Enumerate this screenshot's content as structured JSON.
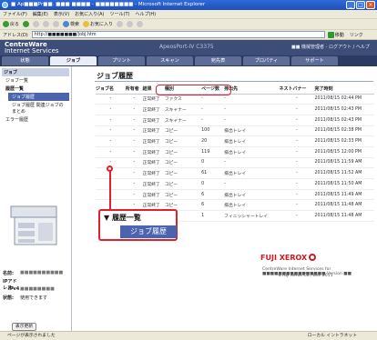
{
  "window": {
    "title": "■ Ap■■■Pr■■. ■■■ ■■■■ - ■■■■■■■■ - Microsoft Internet Explorer",
    "menu": [
      "ファイル(F)",
      "編集(E)",
      "表示(V)",
      "お気に入り(A)",
      "ツール(T)",
      "ヘルプ(H)"
    ],
    "toolbar": {
      "back": "戻る",
      "search": "検索",
      "favorites": "お気に入り"
    },
    "address_label": "アドレス(D)",
    "address_url": "http://■■■■■■■/jobj.htm",
    "go_label": "移動",
    "links_label": "リンク"
  },
  "header": {
    "brand_line1": "CentreWare",
    "brand_line2": "Internet Services",
    "model": "ApeosPort-IV C3375",
    "admin": "■■ 機械管理者 - ログアウト / ヘルプ"
  },
  "tabs": [
    "状態",
    "ジョブ",
    "プリント",
    "スキャン",
    "宛先表",
    "プロパティ",
    "サポート"
  ],
  "sidebar": {
    "section": "ジョブ",
    "items": [
      "ジョブ一覧",
      "履歴一覧",
      "ジョブ履歴",
      "ジョブ履歴 関連ジョブのまとめ",
      "エラー履歴"
    ],
    "info": {
      "name_label": "名前:",
      "name_value": "■■■■■■■■■■",
      "ip_label": "IPアドレス:",
      "ipv4_label": "IPv4",
      "ipv4_value": "■■■■■■■■",
      "status_label": "状態:",
      "status_value": "使用できます"
    },
    "refresh_label": "表示更新"
  },
  "main": {
    "title": "ジョブ履歴",
    "columns": [
      "ジョブ名",
      "所有者",
      "結果",
      "種別",
      "ページ数",
      "排出先",
      "ネストバナー",
      "完了時刻"
    ],
    "rows": [
      [
        "-",
        "-",
        "正常終了",
        "ファクス",
        "-",
        "-",
        "-",
        "2011/08/15 02:44 PM"
      ],
      [
        "-",
        "-",
        "正常終了",
        "スキャナー",
        "-",
        "-",
        "-",
        "2011/08/15 02:43 PM"
      ],
      [
        "-",
        "-",
        "正常終了",
        "スキャナー",
        "-",
        "-",
        "-",
        "2011/08/15 02:43 PM"
      ],
      [
        "-",
        "-",
        "正常終了",
        "コピー",
        "100",
        "排出トレイ",
        "-",
        "2011/08/15 02:38 PM"
      ],
      [
        "-",
        "-",
        "正常終了",
        "コピー",
        "20",
        "排出トレイ",
        "-",
        "2011/08/15 02:33 PM"
      ],
      [
        "-",
        "-",
        "正常終了",
        "コピー",
        "119",
        "排出トレイ",
        "-",
        "2011/08/15 12:00 PM"
      ],
      [
        "-",
        "-",
        "正常終了",
        "コピー",
        "0",
        "-",
        "-",
        "2011/08/15 11:59 AM"
      ],
      [
        "-",
        "-",
        "正常終了",
        "コピー",
        "61",
        "排出トレイ",
        "-",
        "2011/08/15 11:52 AM"
      ],
      [
        "-",
        "-",
        "正常終了",
        "コピー",
        "0",
        "-",
        "-",
        "2011/08/15 11:50 AM"
      ],
      [
        "-",
        "-",
        "正常終了",
        "コピー",
        "6",
        "排出トレイ",
        "-",
        "2011/08/15 11:49 AM"
      ],
      [
        "-",
        "-",
        "正常終了",
        "コピー",
        "6",
        "排出トレイ",
        "-",
        "2011/08/15 11:48 AM"
      ],
      [
        "-",
        "-",
        "正常終了",
        "コピー",
        "1",
        "フィニッシャートレイ",
        "-",
        "2011/08/15 11:48 AM"
      ]
    ],
    "callout": {
      "line1": "▼ 履歴一覧",
      "line2": "ジョブ履歴"
    }
  },
  "footer": {
    "logo": "FUJI XEROX",
    "line1": "CentreWare Internet Services for ■■■■■■■■■■■■■■■■ Version ■■",
    "line2": "©Fuji Xerox Co., Ltd. 2011"
  },
  "statusbar": {
    "left": "ページが表示されました",
    "right": "ローカル イントラネット"
  },
  "colors": {
    "accent": "#e0202c",
    "header": "#3c4d78",
    "selected": "#4a64ad"
  }
}
